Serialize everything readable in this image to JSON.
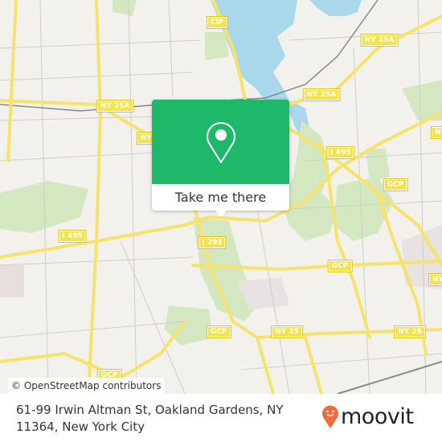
{
  "map": {
    "colors": {
      "land": "#f2f1ec",
      "water": "#a9d8ea",
      "park": "#d3e8c1",
      "road": "#f7e36a",
      "minor": "#cfcdc6",
      "rail": "#888888"
    },
    "shields": [
      {
        "id": "cip",
        "label": "CIP"
      },
      {
        "id": "ny25a-1",
        "label": "NY 25A"
      },
      {
        "id": "ny25a-2",
        "label": "NY 25A"
      },
      {
        "id": "ny25a-3",
        "label": "NY 25A"
      },
      {
        "id": "ny-1",
        "label": "NY"
      },
      {
        "id": "i495-1",
        "label": "I 495"
      },
      {
        "id": "gcp-1",
        "label": "GCP"
      },
      {
        "id": "i495-2",
        "label": "I 495"
      },
      {
        "id": "i295",
        "label": "I 295"
      },
      {
        "id": "gcp-2",
        "label": "GCP"
      },
      {
        "id": "gcp-3",
        "label": "GCP"
      },
      {
        "id": "ny25-1",
        "label": "NY 25"
      },
      {
        "id": "ny25-2",
        "label": "NY 25"
      },
      {
        "id": "gcp-4",
        "label": "GCP"
      },
      {
        "id": "ny-2",
        "label": "NY"
      },
      {
        "id": "ny-3",
        "label": "NY"
      }
    ],
    "attribution": "© OpenStreetMap contributors"
  },
  "popup": {
    "icon": "location-pin-icon",
    "button_label": "Take me there",
    "color": "#1db86a"
  },
  "footer": {
    "address": "61-99 Irwin Altman St, Oakland Gardens, NY 11364, New York City",
    "brand": "moovit",
    "brand_color": "#f26b3a"
  }
}
